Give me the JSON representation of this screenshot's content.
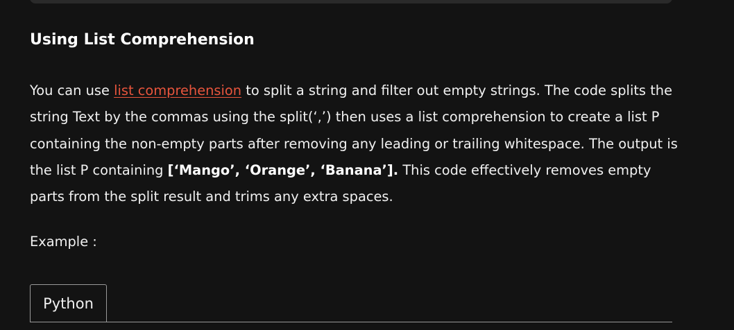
{
  "section": {
    "heading": "Using List Comprehension",
    "paragraph": {
      "before_link": "You can use ",
      "link_text": "list comprehension",
      "after_link": " to split a string and filter out empty strings. The code splits the string Text by the commas using the split(‘,’) then uses a list comprehension to create a list P containing the non-empty parts after removing any leading or trailing whitespace. The output is the list P containing ",
      "bold_result": "[‘Mango’, ‘Orange’, ‘Banana’].",
      "after_bold": " This code effectively removes empty parts from the split result and trims any extra spaces."
    },
    "example_label": "Example :"
  },
  "code_tabs": {
    "active_tab": "Python"
  },
  "colors": {
    "background": "#131313",
    "text": "#f1f1f1",
    "link": "#e8553d",
    "panel": "#2a2a2a",
    "tab_border": "#9a9a9a"
  }
}
